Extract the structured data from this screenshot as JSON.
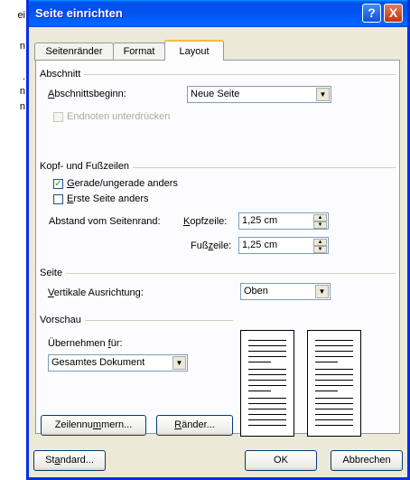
{
  "background_text": [
    "ei",
    "n",
    ".",
    "n",
    "n"
  ],
  "dialog": {
    "title": "Seite einrichten",
    "help_button": "?",
    "close_button": "X"
  },
  "tabs": [
    {
      "label": "Seitenränder",
      "active": false
    },
    {
      "label": "Format",
      "active": false
    },
    {
      "label": "Layout",
      "active": true
    }
  ],
  "abschnitt": {
    "group_label": "Abschnitt",
    "beginn_label_u": "A",
    "beginn_label_rest": "bschnittsbeginn:",
    "beginn_value": "Neue Seite",
    "endnoten_label": "Endnoten unterdrücken",
    "endnoten_checked": false
  },
  "kopf": {
    "group_label": "Kopf- und Fußzeilen",
    "gerade_label_u": "G",
    "gerade_label_rest": "erade/ungerade anders",
    "gerade_checked": true,
    "erste_label_u": "E",
    "erste_label_rest": "rste Seite anders",
    "erste_checked": false,
    "abstand_label": "Abstand vom Seitenrand:",
    "kopfzeile_label_u": "K",
    "kopfzeile_label_rest": "opfzeile:",
    "kopfzeile_value": "1,25 cm",
    "fusszeile_label_pre": "Fuß",
    "fusszeile_label_u": "z",
    "fusszeile_label_rest": "eile:",
    "fusszeile_value": "1,25 cm"
  },
  "seite": {
    "group_label": "Seite",
    "ausrichtung_label_u": "V",
    "ausrichtung_label_rest": "ertikale Ausrichtung:",
    "ausrichtung_value": "Oben"
  },
  "vorschau": {
    "group_label": "Vorschau",
    "uebernehmen_label_pre": "Übernehmen ",
    "uebernehmen_label_u": "f",
    "uebernehmen_label_rest": "ür:",
    "uebernehmen_value": "Gesamtes Dokument"
  },
  "buttons": {
    "zeilennummern_pre": "Zeilennu",
    "zeilennummern_u": "m",
    "zeilennummern_rest": "mern...",
    "raender_u": "R",
    "raender_rest": "änder...",
    "standard_pre": "St",
    "standard_u": "a",
    "standard_rest": "ndard...",
    "ok": "OK",
    "abbrechen": "Abbrechen"
  }
}
